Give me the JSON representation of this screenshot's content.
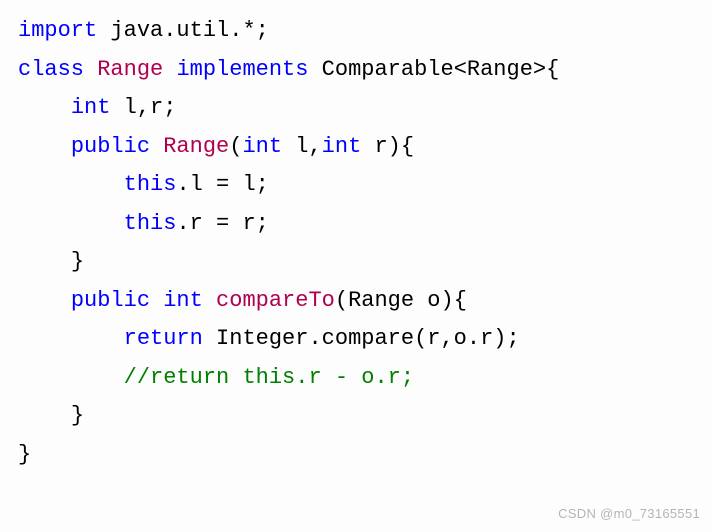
{
  "code": {
    "line1_import": "import",
    "line1_pkg": " java.util.*;",
    "line2_class": "class",
    "line2_name": " Range ",
    "line2_impl": "implements",
    "line2_iface": " Comparable",
    "line2_generic": "<Range>{",
    "line3_indent": "    ",
    "line3_type": "int",
    "line3_vars": " l,r;",
    "line4_indent": "    ",
    "line4_public": "public",
    "line4_space": " ",
    "line4_name": "Range",
    "line4_open": "(",
    "line4_pint1": "int",
    "line4_arg1": " l,",
    "line4_pint2": "int",
    "line4_arg2": " r){",
    "line5_indent": "        ",
    "line5_this": "this",
    "line5_rest": ".l = l;",
    "line6_indent": "        ",
    "line6_this": "this",
    "line6_rest": ".r = r;",
    "line7_indent": "    ",
    "line7_brace": "}",
    "line8_indent": "    ",
    "line8_public": "public",
    "line8_space": " ",
    "line8_int": "int",
    "line8_space2": " ",
    "line8_name": "compareTo",
    "line8_args": "(Range o){",
    "line9_indent": "        ",
    "line9_return": "return",
    "line9_rest": " Integer.compare(r,o.r);",
    "line10_indent": "        ",
    "line10_comment": "//return this.r - o.r;",
    "line11_indent": "    ",
    "line11_brace": "}",
    "line12_brace": "}"
  },
  "watermark": "CSDN @m0_73165551"
}
